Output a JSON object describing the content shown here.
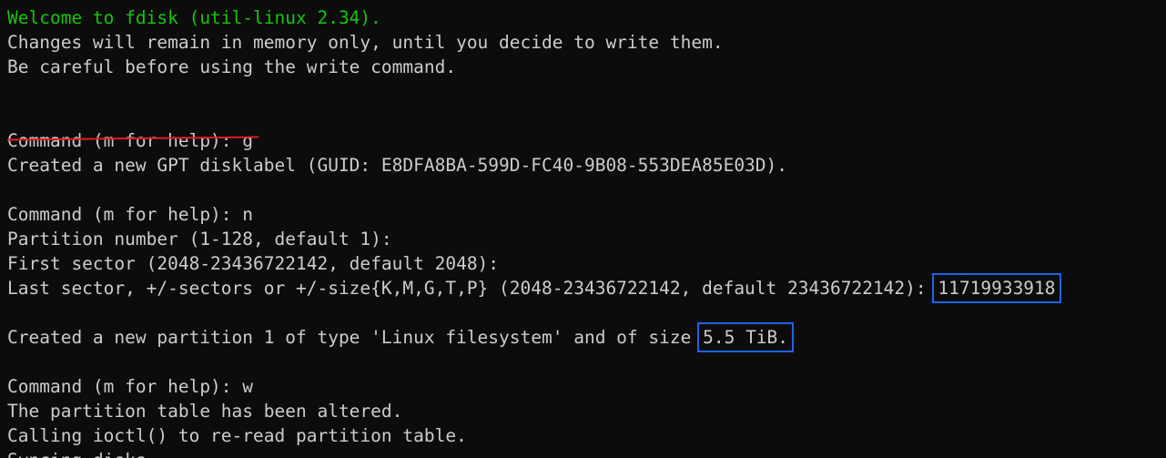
{
  "terminal": {
    "welcome": "Welcome to fdisk (util-linux 2.34).",
    "changes_note": "Changes will remain in memory only, until you decide to write them.",
    "careful_note": "Be careful before using the write command.",
    "cmd_g_prompt": "Command (m for help): g",
    "created_gpt": "Created a new GPT disklabel (GUID: E8DFA8BA-599D-FC40-9B08-553DEA85E03D).",
    "cmd_n_prompt": "Command (m for help): n",
    "partition_number": "Partition number (1-128, default 1):",
    "first_sector": "First sector (2048-23436722142, default 2048):",
    "last_sector_prompt": "Last sector, +/-sectors or +/-size{K,M,G,T,P} (2048-23436722142, default 23436722142):",
    "last_sector_value": "11719933918",
    "created_partition_prefix": "Created a new partition 1 of type 'Linux filesystem' and of size",
    "partition_size": "5.5 TiB.",
    "cmd_w_prompt": "Command (m for help): w",
    "table_altered": "The partition table has been altered.",
    "calling_ioctl": "Calling ioctl() to re-read partition table.",
    "syncing": "Syncing disks."
  },
  "colors": {
    "background": "#0c0c0c",
    "text": "#cccccc",
    "welcome_green": "#16c60c",
    "strike_red": "#e21c1c",
    "highlight_blue": "#1e63e9"
  }
}
